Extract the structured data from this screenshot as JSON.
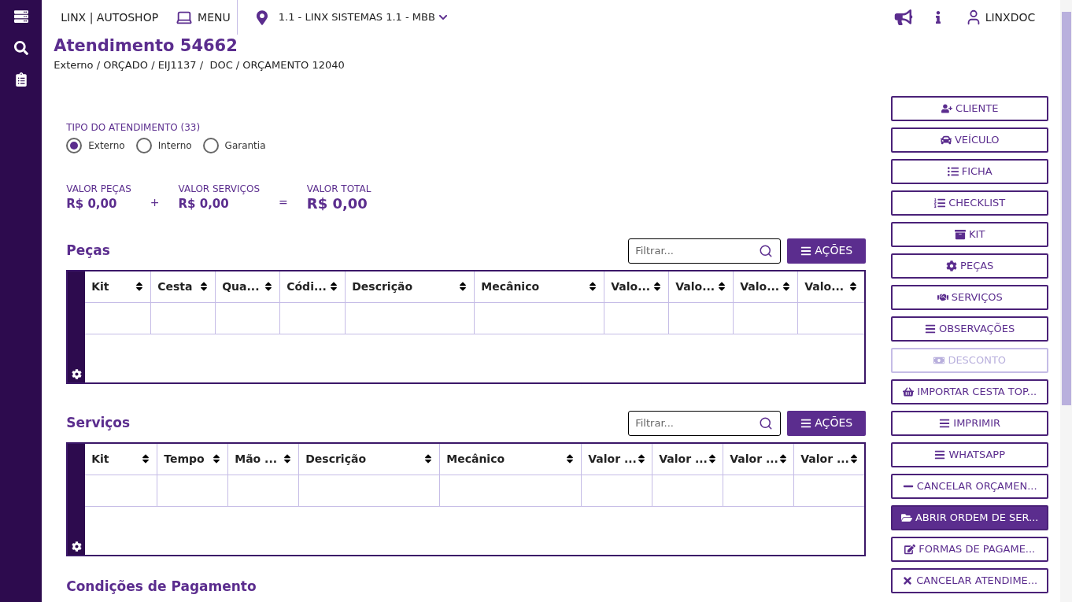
{
  "header": {
    "brand": "LINX | AUTOSHOP",
    "menu": "MENU",
    "location": "1.1 - LINX SISTEMAS 1.1 - MBB",
    "user": "LINXDOC"
  },
  "page": {
    "title": "Atendimento 54662",
    "subtitle": "Externo / ORÇADO / EIJ1137 /  DOC / ORÇAMENTO 12040"
  },
  "tipo": {
    "label": "TIPO DO ATENDIMENTO (33)",
    "options": [
      {
        "label": "Externo",
        "selected": true
      },
      {
        "label": "Interno",
        "selected": false
      },
      {
        "label": "Garantia",
        "selected": false
      }
    ]
  },
  "totals": [
    {
      "label": "VALOR PEÇAS",
      "value": "R$ 0,00",
      "operator": "+"
    },
    {
      "label": "VALOR SERVIÇOS",
      "value": "R$ 0,00",
      "operator": "="
    },
    {
      "label": "VALOR TOTAL",
      "value": "R$ 0,00"
    }
  ],
  "sections": [
    {
      "kind": "parts",
      "title": "Peças",
      "filter_placeholder": "Filtrar...",
      "actions": "AÇÕES",
      "columns": [
        "Kit",
        "Cesta",
        "Qua...",
        "Códi...",
        "Descrição",
        "Mecânico",
        "Valo...",
        "Valo...",
        "Valo...",
        "Valo..."
      ]
    },
    {
      "kind": "services",
      "title": "Serviços",
      "filter_placeholder": "Filtrar...",
      "actions": "AÇÕES",
      "columns": [
        "Kit",
        "Tempo",
        "Mão ...",
        "Descrição",
        "Mecânico",
        "Valor ...",
        "Valor ...",
        "Valor ...",
        "Valor ..."
      ]
    },
    {
      "kind": "payment",
      "title": "Condições de Pagamento"
    }
  ],
  "action_buttons": [
    {
      "label": "CLIENTE",
      "disabled": false,
      "highlighted": false
    },
    {
      "label": "VEÍCULO",
      "disabled": false,
      "highlighted": false
    },
    {
      "label": "FICHA",
      "disabled": false,
      "highlighted": false
    },
    {
      "label": "CHECKLIST",
      "disabled": false,
      "highlighted": false
    },
    {
      "label": "KIT",
      "disabled": false,
      "highlighted": false
    },
    {
      "label": "PEÇAS",
      "disabled": false,
      "highlighted": false
    },
    {
      "label": "SERVIÇOS",
      "disabled": false,
      "highlighted": false
    },
    {
      "label": "OBSERVAÇÕES",
      "disabled": false,
      "highlighted": false
    },
    {
      "label": "DESCONTO",
      "disabled": true,
      "highlighted": false
    },
    {
      "label": "IMPORTAR CESTA TOP...",
      "disabled": false,
      "highlighted": false
    },
    {
      "label": "IMPRIMIR",
      "disabled": false,
      "highlighted": false
    },
    {
      "label": "WHATSAPP",
      "disabled": false,
      "highlighted": false
    },
    {
      "label": "CANCELAR ORÇAMEN...",
      "disabled": false,
      "highlighted": false
    },
    {
      "label": "ABRIR ORDEM DE SER...",
      "disabled": false,
      "highlighted": true
    },
    {
      "label": "FORMAS DE PAGAME...",
      "disabled": false,
      "highlighted": false
    },
    {
      "label": "CANCELAR ATENDIME...",
      "disabled": false,
      "highlighted": false
    }
  ]
}
